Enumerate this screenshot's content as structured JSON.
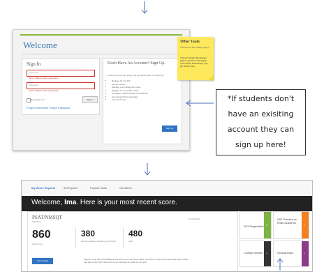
{
  "login_page": {
    "welcome_title": "Welcome",
    "signin": {
      "title": "Sign In",
      "username_placeholder": "Username",
      "username_error": "Error: Please enter a username",
      "password_placeholder": "Password",
      "password_error": "Error: Please enter a password",
      "remember_label": "Remember me",
      "signin_button": "Sign In",
      "forgot_links": "Forgot Username  Forgot Password"
    },
    "signup": {
      "title": "Don't Have An Account? Sign Up.",
      "intro": "Create your account today and get started with the following:",
      "benefits": [
        "Register for the SAT",
        "Get AP scores",
        "Manage your college list online",
        "Register for the CLEP exams",
        "Complete CSS/Financial Aid PROFILE",
        "Use the Net Price Calculator",
        "And much more"
      ],
      "signup_button": "Sign Up"
    },
    "other_tools": {
      "title": "Other Tools",
      "text": "Welcome to the College Board.",
      "student_info_text": "Visit our Student Information page to get more information. Learn about financial aid, and get started now."
    }
  },
  "callout": {
    "lines": [
      "*If students don't",
      "have an exisiting",
      "account they can",
      "sign up here!"
    ]
  },
  "dashboard": {
    "nav": [
      "My Score Reports",
      "All Reports",
      "Popular Tools",
      "Get Alerts"
    ],
    "welcome_prefix": "Welcome,",
    "welcome_name": "Ima",
    "welcome_suffix": ". Here is your most recent score.",
    "score_card": {
      "test_name": "PSAT/NMSQT",
      "test_date": "Fall 2013",
      "details_link": "9-Dk Details",
      "total_score": "860",
      "total_label": "Total Score",
      "ebrw_score": "380",
      "ebrw_label": "Evidence-Based Reading and Writing",
      "math_score": "480",
      "math_label": "Math",
      "view_button": "View details",
      "keep_text": "Keep in mind, the PSAT/NMSQT and SAT are on the same scale. Your score shows how you would have scored that day on the SAT. How well you do depends on what you do next!"
    },
    "tiles": [
      {
        "label": "SAT Registration",
        "color": "#7cb342"
      },
      {
        "label": "SAT Practice on Khan Academy",
        "color": "#f4801f"
      },
      {
        "label": "College Search",
        "color": "#333333"
      },
      {
        "label": "Scholarships",
        "color": "#8e3a8a"
      }
    ]
  }
}
